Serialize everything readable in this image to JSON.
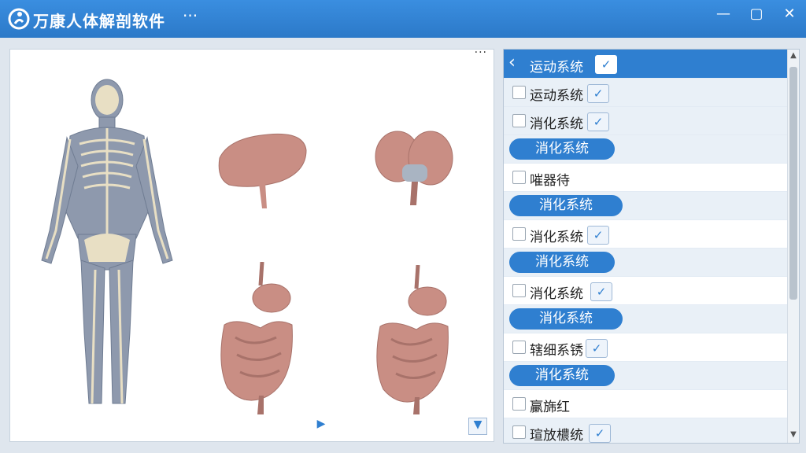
{
  "window": {
    "title": "万康人体解剖软件",
    "more": "···",
    "minimize": "—",
    "restore": "▢",
    "close": "✕"
  },
  "viewer": {
    "more": "···",
    "next": "▶",
    "expand": "▼"
  },
  "list": {
    "header": {
      "label": "运动系统",
      "check": "✓"
    },
    "rows": [
      {
        "label": "运动系统",
        "check": "✓"
      },
      {
        "label": "消化系统",
        "check": "✓"
      },
      {
        "label": "消化系统"
      },
      {
        "label": "嗺器待"
      },
      {
        "label": "消化系统"
      },
      {
        "label": "消化系统",
        "check": "✓"
      },
      {
        "label": "消化系统"
      },
      {
        "label": "消化系统",
        "check": "✓"
      },
      {
        "label": "消化系统"
      },
      {
        "label": "辖细系锈",
        "check": "✓"
      },
      {
        "label": "消化系统"
      },
      {
        "label": "臝旆红"
      },
      {
        "label": "瑄放檂统",
        "check": "✓"
      }
    ]
  },
  "colors": {
    "accent": "#2f7fd0",
    "organ": "#c98e84"
  }
}
